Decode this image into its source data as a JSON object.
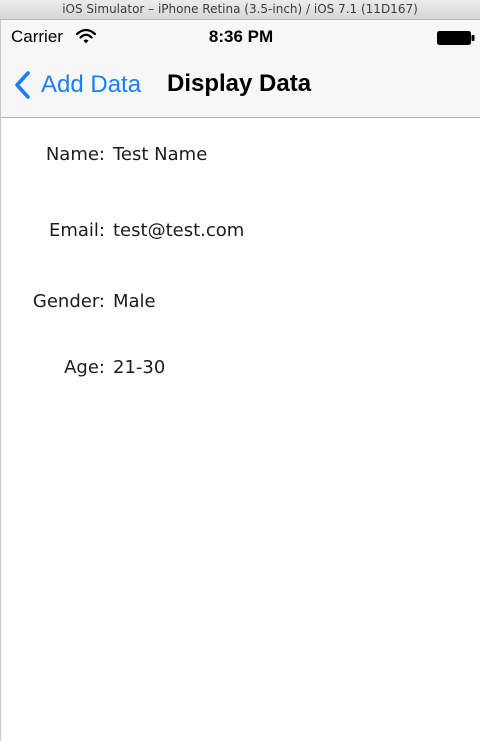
{
  "simulator": {
    "title": "iOS Simulator – iPhone Retina (3.5-inch) / iOS 7.1 (11D167)"
  },
  "status_bar": {
    "carrier": "Carrier",
    "time": "8:36 PM",
    "wifi_icon": "wifi-icon",
    "battery_icon": "battery-full-icon"
  },
  "navigation": {
    "back_label": "Add Data",
    "title": "Display Data"
  },
  "fields": [
    {
      "label": "Name:",
      "value": "Test Name"
    },
    {
      "label": "Email:",
      "value": "test@test.com"
    },
    {
      "label": "Gender:",
      "value": "Male"
    },
    {
      "label": "Age:",
      "value": "21-30"
    }
  ],
  "colors": {
    "accent": "#1a7ef5",
    "nav_background": "#f7f7f7",
    "text": "#1c1c1c"
  }
}
